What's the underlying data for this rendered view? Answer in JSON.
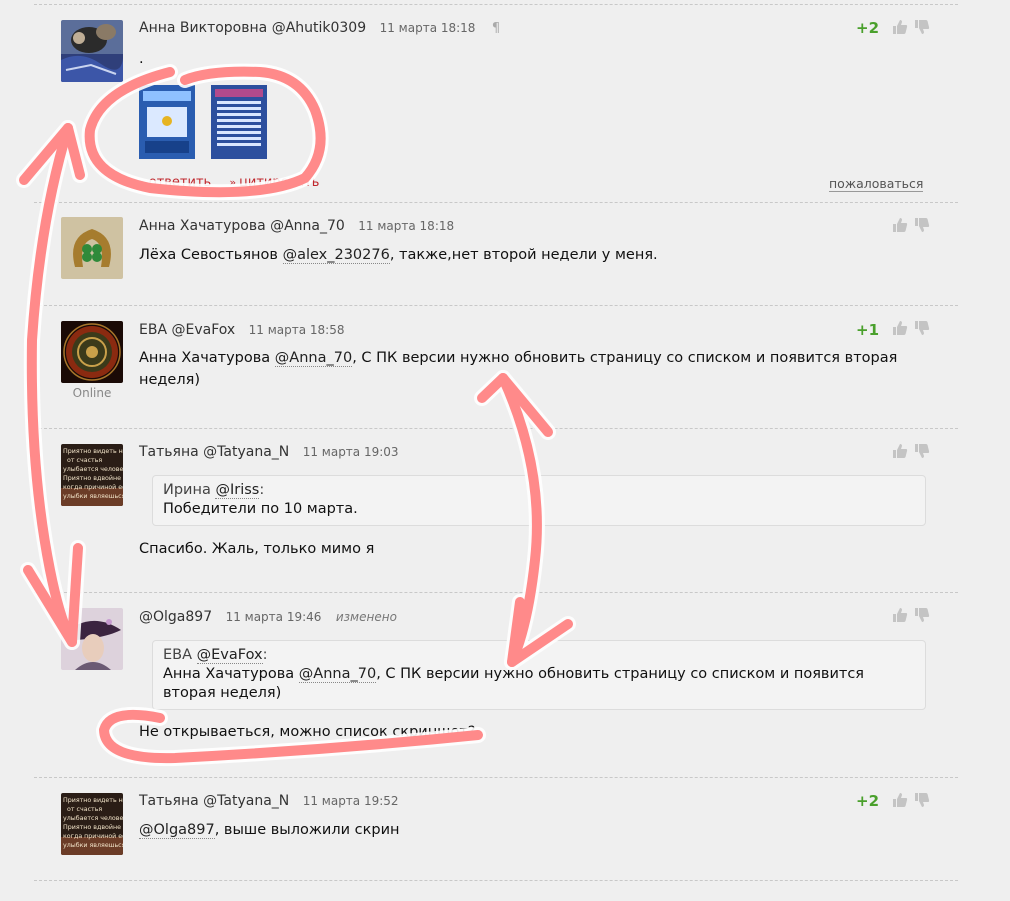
{
  "comments": [
    {
      "author": "Анна Викторовна",
      "handle": "@Ahutik0309",
      "time": "11 марта 18:18",
      "pilcrow": "¶",
      "score": "+2",
      "text": ".",
      "reply": "ответить",
      "quote_btn": "цитировать",
      "complain": "пожаловаться"
    },
    {
      "author": "Анна Хачатурова",
      "handle": "@Anna_70",
      "time": "11 марта 18:18",
      "mention": "Лёха Севостьянов",
      "mention_handle": "@alex_230276",
      "text": ", также,нет второй недели у меня."
    },
    {
      "author": "ЕВА",
      "handle": "@EvaFox",
      "time": "11 марта 18:58",
      "score": "+1",
      "online": "Online",
      "mention": "Анна Хачатурова",
      "mention_handle": "@Anna_70",
      "text": ", С ПК версии нужно обновить страницу со списком и появится вторая неделя)"
    },
    {
      "author": "Татьяна",
      "handle": "@Tatyana_N",
      "time": "11 марта 19:03",
      "quote_author": "Ирина",
      "quote_handle": "@Iriss",
      "quote_text": "Победители по 10 марта.",
      "text": "Спасибо. Жаль, только мимо я"
    },
    {
      "handle": "@Olga897",
      "time": "11 марта 19:46",
      "edited": "изменено",
      "quote_author": "ЕВА",
      "quote_handle": "@EvaFox",
      "quote_mention": "Анна Хачатурова",
      "quote_mention_handle": "@Anna_70",
      "quote_text": ", С ПК версии нужно обновить страницу со списком и появится вторая неделя)",
      "text": "Не открываеться, можно список скриншот?"
    },
    {
      "author": "Татьяна",
      "handle": "@Tatyana_N",
      "time": "11 марта 19:52",
      "score": "+2",
      "mention_handle": "@Olga897",
      "text": ", выше выложили скрин"
    }
  ],
  "avatar_text": "Приятно видеть на от счастья улыбается человек Приятно вдвойне когда причиной её улыбки являешься",
  "colors": {
    "score": "#4aa02c",
    "link": "#c0272d",
    "annotation": "#ff8080"
  }
}
